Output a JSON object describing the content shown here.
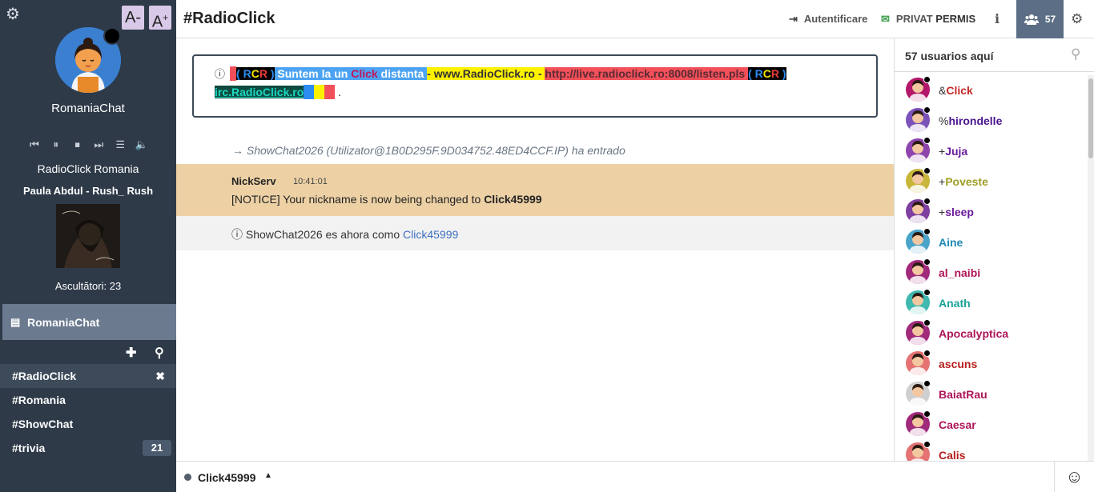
{
  "sidebar": {
    "font_decrease": "A-",
    "font_increase_base": "A",
    "font_increase_sup": "+",
    "nickname": "RomaniaChat",
    "radio_name": "RadioClick Romania",
    "track": "Paula Abdul - Rush_ Rush",
    "listeners": "Ascultători: 23",
    "server": "RomaniaChat",
    "channels": [
      {
        "name": "#RadioClick",
        "active": true,
        "close": "✖"
      },
      {
        "name": "#Romania"
      },
      {
        "name": "#ShowChat"
      },
      {
        "name": "#trivia",
        "badge": "21"
      }
    ]
  },
  "header": {
    "channel": "#RadioClick",
    "auth": "Autentificare",
    "private_label": "PRIVAT",
    "private_state": "PERMIS",
    "info": "i",
    "users_count": "57"
  },
  "topic": {
    "r": "R",
    "c": "C",
    "r2": "R",
    "open": "( ",
    "close": " )",
    "slogan_a": " Suntem la un ",
    "click": "Click",
    "slogan_b": " distanta ",
    "site": " - www.RadioClick.ro - ",
    "stream": " http://live.radioclick.ro:8008/listen.pls ",
    "irc": "irc.RadioClick.ro",
    "end": "."
  },
  "messages": {
    "join": "→ ShowChat2026 (Utilizator@1B0D295F.9D034752.48ED4CCF.IP) ha entrado",
    "notice_from": "NickServ",
    "notice_time": "10:41:01",
    "notice_text": "[NOTICE] Your nickname is now being changed to ",
    "notice_nick": "Click45999",
    "nickchange_text": "ShowChat2026 es ahora como ",
    "nickchange_nick": "Click45999"
  },
  "users": {
    "header": "57 usuarios aquí",
    "list": [
      {
        "prefix": "&",
        "name": "Click",
        "color": "#c62828",
        "avatar": "#b3186a"
      },
      {
        "prefix": "%",
        "name": "hirondelle",
        "color": "#4a148c",
        "avatar": "#7b52b9"
      },
      {
        "prefix": "+",
        "name": "Juja",
        "color": "#6a1b9a",
        "avatar": "#8e44ad"
      },
      {
        "prefix": "+",
        "name": "Poveste",
        "color": "#9e9d24",
        "avatar": "#c8b63a"
      },
      {
        "prefix": "+",
        "name": "sleep",
        "color": "#6a1b9a",
        "avatar": "#7e3fa0"
      },
      {
        "prefix": "",
        "name": "Aine",
        "color": "#1e88b5",
        "avatar": "#4aa3c9"
      },
      {
        "prefix": "",
        "name": "al_naibi",
        "color": "#ad1457",
        "avatar": "#a12a7a"
      },
      {
        "prefix": "",
        "name": "Anath",
        "color": "#1aa39a",
        "avatar": "#3fb8b0"
      },
      {
        "prefix": "",
        "name": "Apocalyptica",
        "color": "#ad1457",
        "avatar": "#a12a7a"
      },
      {
        "prefix": "",
        "name": "ascuns",
        "color": "#b71c1c",
        "avatar": "#e57373"
      },
      {
        "prefix": "",
        "name": "BaiatRau",
        "color": "#ad1457",
        "avatar": "#cfcfcf"
      },
      {
        "prefix": "",
        "name": "Caesar",
        "color": "#ad1457",
        "avatar": "#a12a7a"
      },
      {
        "prefix": "",
        "name": "Calis",
        "color": "#b71c1c",
        "avatar": "#e57373"
      }
    ]
  },
  "input": {
    "nick": "Click45999"
  },
  "colors": {
    "sidebar_bg": "#2e3a48",
    "accent": "#5b6e85",
    "notice_bg": "#edd1a5"
  }
}
